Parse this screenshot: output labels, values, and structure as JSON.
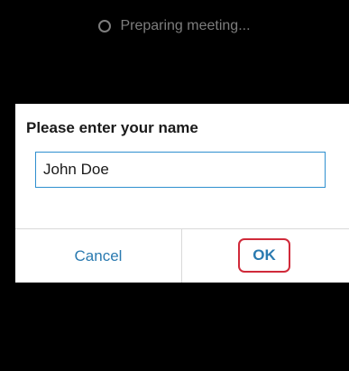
{
  "status": {
    "text": "Preparing meeting...",
    "icon": "spinner-icon"
  },
  "dialog": {
    "title": "Please enter your name",
    "name_input": {
      "value": "John Doe",
      "placeholder": ""
    },
    "cancel_label": "Cancel",
    "ok_label": "OK"
  },
  "colors": {
    "background": "#000000",
    "dialog_bg": "#ffffff",
    "accent": "#2a7ab0",
    "input_border": "#2f8fcf",
    "highlight": "#d02a3a"
  }
}
